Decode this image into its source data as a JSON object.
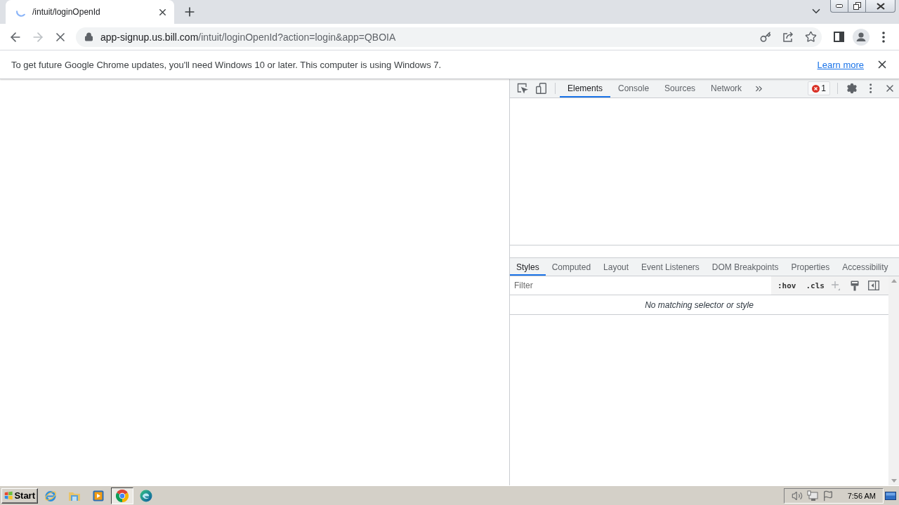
{
  "browser": {
    "tab": {
      "title": "/intuit/loginOpenId",
      "loading": true
    },
    "nav_buttons": [
      {
        "kind": "back",
        "disabled": false
      },
      {
        "kind": "forward",
        "disabled": true
      },
      {
        "kind": "stop",
        "disabled": false
      }
    ],
    "address": {
      "host": "app-signup.us.bill.com",
      "path": "/intuit/loginOpenId?action=login&app=QBOIA"
    }
  },
  "infobar": {
    "message": "To get future Google Chrome updates, you'll need Windows 10 or later. This computer is using Windows 7.",
    "link": "Learn more"
  },
  "devtools": {
    "tabs": [
      {
        "label": "Elements",
        "selected": true
      },
      {
        "label": "Console",
        "selected": false
      },
      {
        "label": "Sources",
        "selected": false
      },
      {
        "label": "Network",
        "selected": false
      }
    ],
    "error_count": "1",
    "styles_tabs": [
      {
        "label": "Styles",
        "selected": true
      },
      {
        "label": "Computed",
        "selected": false
      },
      {
        "label": "Layout",
        "selected": false
      },
      {
        "label": "Event Listeners",
        "selected": false
      },
      {
        "label": "DOM Breakpoints",
        "selected": false
      },
      {
        "label": "Properties",
        "selected": false
      },
      {
        "label": "Accessibility",
        "selected": false
      }
    ],
    "filter": {
      "placeholder": "Filter"
    },
    "style_toggles": [
      ":hov",
      ".cls"
    ],
    "empty_message": "No matching selector or style"
  },
  "taskbar": {
    "start": "Start",
    "apps": [
      {
        "kind": "ie",
        "selected": false
      },
      {
        "kind": "explorer",
        "selected": false
      },
      {
        "kind": "media",
        "selected": false
      },
      {
        "kind": "chrome",
        "selected": true
      },
      {
        "kind": "edge",
        "selected": false
      }
    ],
    "clock": "7:56 AM"
  }
}
